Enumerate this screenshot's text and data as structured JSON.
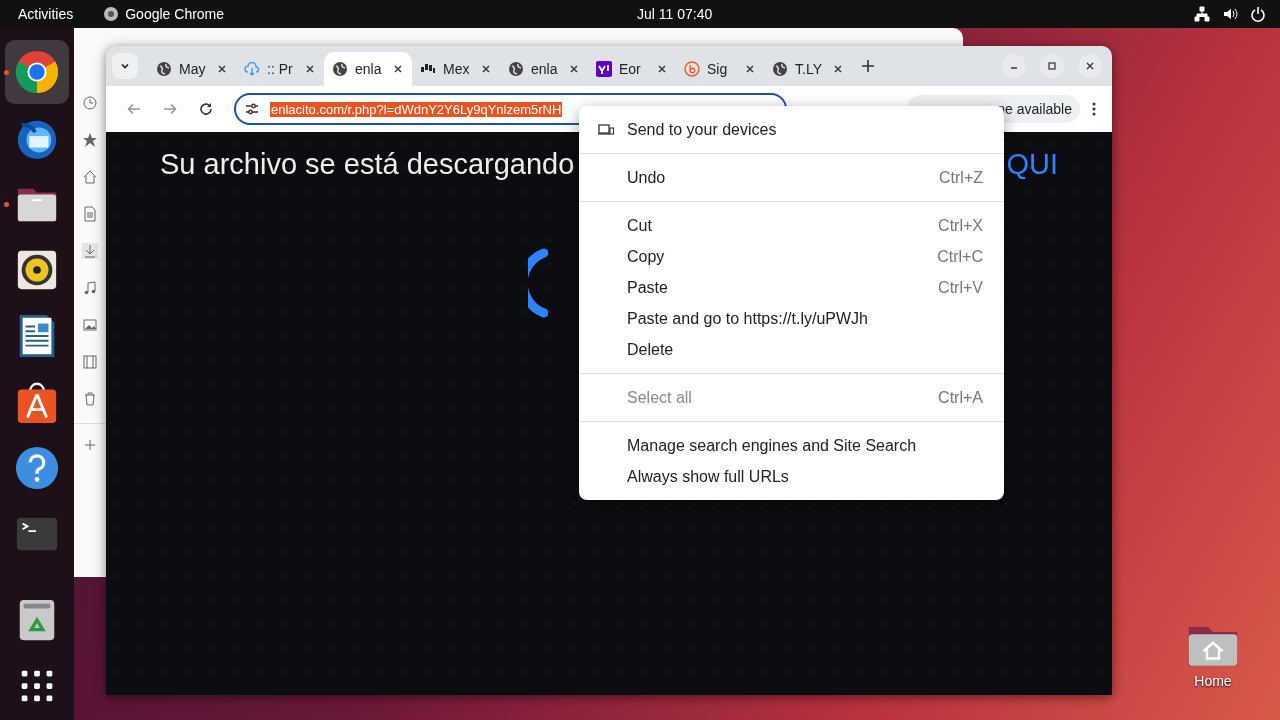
{
  "top_bar": {
    "activities": "Activities",
    "app": "Google Chrome",
    "clock": "Jul 11  07:40"
  },
  "dock": [
    {
      "kind": "chrome",
      "running": true,
      "selected": true
    },
    {
      "kind": "mail",
      "running": false,
      "selected": false
    },
    {
      "kind": "files",
      "running": true,
      "selected": false
    },
    {
      "kind": "speaker",
      "running": false,
      "selected": false
    },
    {
      "kind": "writer",
      "running": false,
      "selected": false
    },
    {
      "kind": "store",
      "running": false,
      "selected": false
    },
    {
      "kind": "help",
      "running": false,
      "selected": false
    },
    {
      "kind": "terminal",
      "running": false,
      "selected": false
    },
    {
      "kind": "trash",
      "running": false,
      "selected": false
    },
    {
      "kind": "apps",
      "running": false,
      "selected": false
    }
  ],
  "browser": {
    "tabs": [
      {
        "kind": "globe",
        "label": "May",
        "selected": false
      },
      {
        "kind": "cloud",
        "label": ":: Pr",
        "selected": false
      },
      {
        "kind": "globe",
        "label": "enla",
        "selected": true
      },
      {
        "kind": "bars",
        "label": "Mex",
        "selected": false
      },
      {
        "kind": "globe",
        "label": "enla",
        "selected": false
      },
      {
        "kind": "yahoo",
        "label": "Eor",
        "selected": false
      },
      {
        "kind": "bitly",
        "label": "Sig",
        "selected": false
      },
      {
        "kind": "globe",
        "label": "T.LY",
        "selected": false
      }
    ],
    "url": "enlacito.com/r.php?l=dWdnY2Y6Ly9qYnlzem5rNH",
    "update_button": "ne available",
    "page": {
      "heading": "Su archivo se está descargando",
      "link": "QUI"
    }
  },
  "context_menu": [
    {
      "kind": "item",
      "label": "Send to your devices",
      "icon": true,
      "disabled": false
    },
    {
      "kind": "separator"
    },
    {
      "kind": "item",
      "label": "Undo",
      "shortcut": "Ctrl+Z",
      "disabled": false
    },
    {
      "kind": "separator"
    },
    {
      "kind": "item",
      "label": "Cut",
      "shortcut": "Ctrl+X",
      "disabled": false
    },
    {
      "kind": "item",
      "label": "Copy",
      "shortcut": "Ctrl+C",
      "disabled": false
    },
    {
      "kind": "item",
      "label": "Paste",
      "shortcut": "Ctrl+V",
      "disabled": false
    },
    {
      "kind": "item",
      "label": "Paste and go to https://t.ly/uPWJh",
      "disabled": false
    },
    {
      "kind": "item",
      "label": "Delete",
      "disabled": false
    },
    {
      "kind": "separator"
    },
    {
      "kind": "item",
      "label": "Select all",
      "shortcut": "Ctrl+A",
      "disabled": true
    },
    {
      "kind": "separator"
    },
    {
      "kind": "item",
      "label": "Manage search engines and Site Search",
      "disabled": false
    },
    {
      "kind": "item",
      "label": "Always show full URLs",
      "disabled": false
    }
  ],
  "desktop": {
    "home": "Home"
  }
}
